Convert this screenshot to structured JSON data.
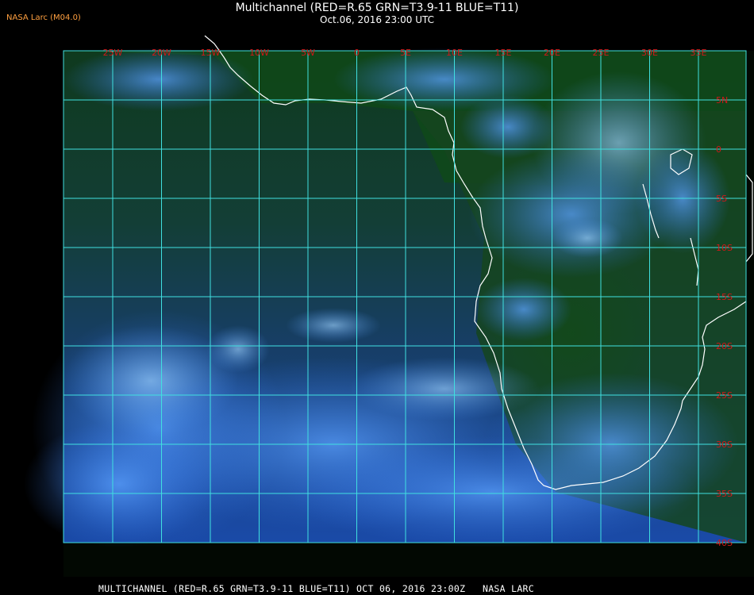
{
  "header": {
    "corner_label": "NASA Larc (M04.0)",
    "title": "Multichannel (RED=R.65 GRN=T3.9-11 BLUE=T11)",
    "subtitle": "Oct.06, 2016 23:00 UTC"
  },
  "footer": {
    "caption": "MULTICHANNEL (RED=R.65 GRN=T3.9-11 BLUE=T11) OCT 06, 2016 23:00Z   NASA LARC"
  },
  "map": {
    "longitude_labels": [
      "25W",
      "20W",
      "15W",
      "10W",
      "5W",
      "0",
      "5E",
      "10E",
      "15E",
      "20E",
      "25E",
      "30E",
      "35E"
    ],
    "latitude_labels": [
      "5N",
      "0",
      "5S",
      "10S",
      "15S",
      "20S",
      "25S",
      "30S",
      "35S",
      "40S"
    ],
    "grid_color": "#40e0e0",
    "label_color": "#d01818",
    "coastline_color": "#ffffff"
  }
}
